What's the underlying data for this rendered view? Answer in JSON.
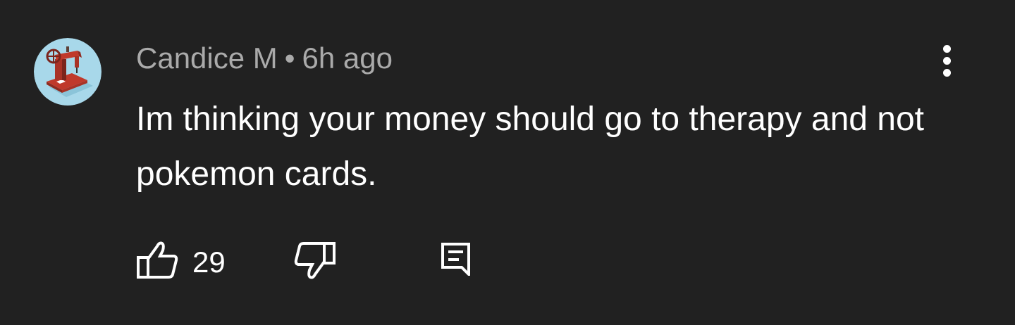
{
  "comment": {
    "author": "Candice M",
    "separator": "•",
    "timestamp": "6h ago",
    "text": "Im thinking your money should go to therapy and not pokemon cards.",
    "avatar_icon": "sewing-machine-avatar",
    "more_icon": "more-vertical-icon"
  },
  "actions": {
    "like_icon": "thumbs-up-icon",
    "like_count": "29",
    "dislike_icon": "thumbs-down-icon",
    "reply_icon": "comment-reply-icon"
  },
  "colors": {
    "background": "#212121",
    "meta_text": "#aaaaaa",
    "body_text": "#ffffff",
    "avatar_bg": "#9fd4e6",
    "avatar_machine": "#c0392b"
  }
}
